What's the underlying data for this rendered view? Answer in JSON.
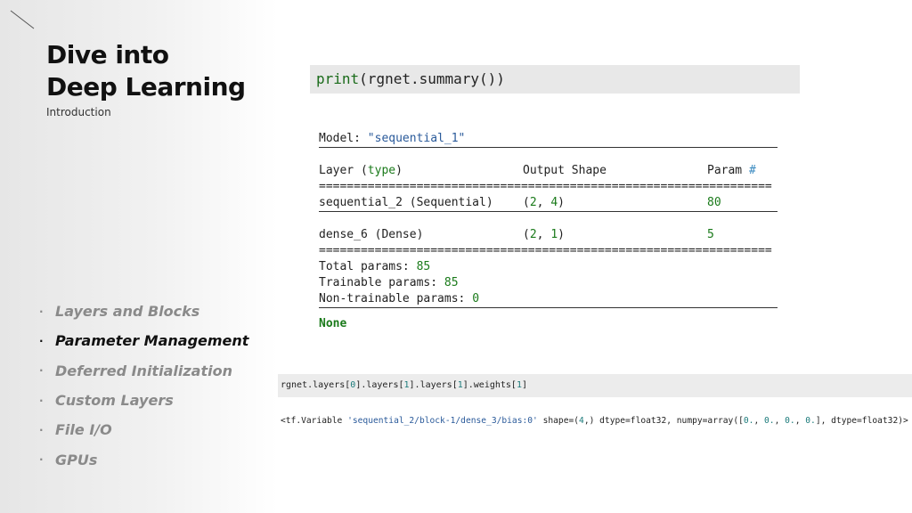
{
  "slide": {
    "title_line1": "Dive into",
    "title_line2": "Deep Learning",
    "subtitle": "Introduction"
  },
  "nav": {
    "items": [
      {
        "label": "Layers and Blocks",
        "active": false
      },
      {
        "label": "Parameter Management",
        "active": true
      },
      {
        "label": "Deferred Initialization",
        "active": false
      },
      {
        "label": "Custom Layers",
        "active": false
      },
      {
        "label": "File I/O",
        "active": false
      },
      {
        "label": "GPUs",
        "active": false
      }
    ],
    "bullet": "·"
  },
  "code_cell": {
    "fn": "print",
    "rest": "(rgnet.summary())"
  },
  "summary": {
    "model_label": "Model: ",
    "model_name": "\"sequential_1\"",
    "header_layer": "Layer (",
    "header_type": "type",
    "header_close": ")",
    "header_output": "Output Shape",
    "header_param": "Param ",
    "header_hash": "#",
    "eq_rule": "=================================================================",
    "rows": [
      {
        "layer": "sequential_2 (Sequential)",
        "shape_a": "2",
        "shape_b": "4",
        "params": "80"
      },
      {
        "layer": "dense_6 (Dense)",
        "shape_a": "2",
        "shape_b": "1",
        "params": "5"
      }
    ],
    "total_label": "Total params: ",
    "total_value": "85",
    "trainable_label": "Trainable params: ",
    "trainable_value": "85",
    "nontrainable_label": "Non-trainable params: ",
    "nontrainable_value": "0",
    "none": "None"
  },
  "code2": {
    "p1": "rgnet.layers[",
    "i1": "0",
    "p2": "].layers[",
    "i2": "1",
    "p3": "].layers[",
    "i3": "1",
    "p4": "].weights[",
    "i4": "1",
    "p5": "]"
  },
  "output2": {
    "prefix": "<tf.Variable ",
    "name": "'sequential_2/block-1/dense_3/bias:0'",
    "shape_label": " shape=(",
    "shape_val": "4",
    "mid": ",) dtype=float32, numpy=array([",
    "v1": "0.",
    "sep": ", ",
    "v2": "0.",
    "v3": "0.",
    "v4": "0.",
    "suffix": "], dtype=float32)>"
  },
  "colors": {
    "accent_green": "#1a7a1a",
    "string_blue": "#2a5a9a",
    "teal": "#1a7a7a"
  }
}
